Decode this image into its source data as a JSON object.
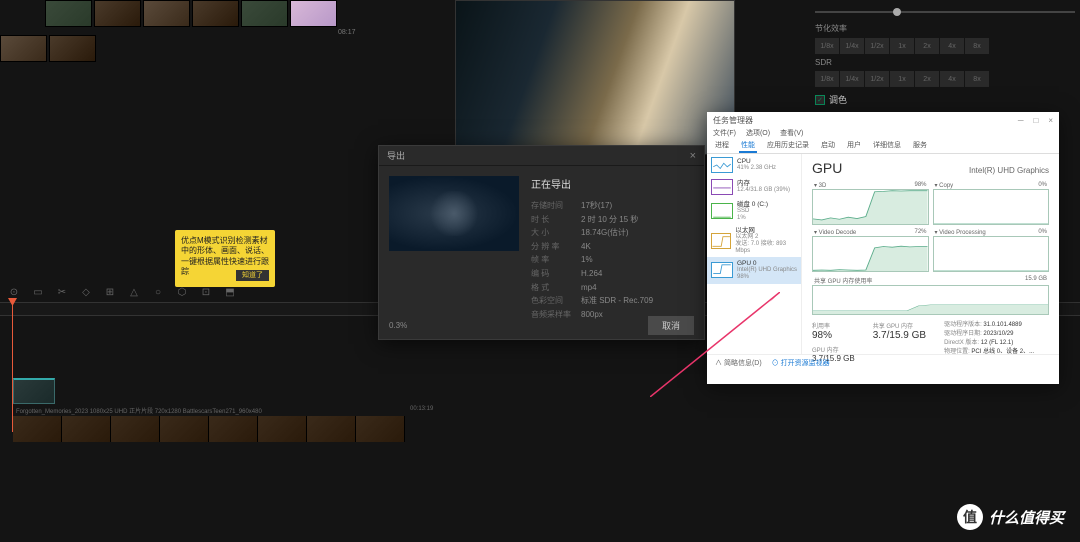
{
  "thumbs": {
    "label_time": "08:17"
  },
  "right_panel": {
    "section1": "节化效率",
    "btns1": [
      "1/8x",
      "1/4x",
      "1/2x",
      "1x",
      "2x",
      "4x",
      "8x"
    ],
    "section2": "SDR",
    "btns2": [
      "1/8x",
      "1/4x",
      "1/2x",
      "1x",
      "2x",
      "4x",
      "8x"
    ],
    "checkbox": "调色"
  },
  "tooltip": {
    "text": "优点M模式识别检测素材中的形体、画面、说话、一键根据属性快速进行跟踪",
    "btn": "知道了"
  },
  "export_dialog": {
    "header": "导出",
    "title": "正在导出",
    "rows": [
      {
        "k": "存储时间",
        "v": "17秒(17)"
      },
      {
        "k": "时 长",
        "v": "2 时 10 分 15 秒"
      },
      {
        "k": "大 小",
        "v": "18.74G(估计)"
      },
      {
        "k": "分 辨 率",
        "v": "4K"
      },
      {
        "k": "帧 率",
        "v": "1%"
      },
      {
        "k": "编 码",
        "v": "H.264"
      },
      {
        "k": "格 式",
        "v": "mp4"
      },
      {
        "k": "色彩空间",
        "v": "标准 SDR - Rec.709"
      },
      {
        "k": "音频采样率",
        "v": "800px"
      }
    ],
    "progress": "0.3%",
    "cancel": "取消"
  },
  "taskmgr": {
    "title": "任务管理器",
    "menu": [
      "文件(F)",
      "选项(O)",
      "查看(V)"
    ],
    "tabs": [
      "进程",
      "性能",
      "应用历史记录",
      "启动",
      "用户",
      "详细信息",
      "服务"
    ],
    "sidebar": [
      {
        "name": "CPU",
        "val": "41% 2.38 GHz",
        "color": "#3a9ad4"
      },
      {
        "name": "内存",
        "val": "12.4/31.8 GB (39%)",
        "color": "#8a4ab4"
      },
      {
        "name": "磁盘 0 (C:)",
        "val": "SSD\n1%",
        "color": "#4ab44a"
      },
      {
        "name": "以太网",
        "val": "以太网 2\n发送: 7.0 接收: 893 Mbps",
        "color": "#d4a43a"
      },
      {
        "name": "GPU 0",
        "val": "Intel(R) UHD Graphics\n98%",
        "color": "#3a9ad4"
      }
    ],
    "main": {
      "title": "GPU",
      "name": "Intel(R) UHD Graphics",
      "charts": [
        {
          "label": "3D",
          "pct": "98%"
        },
        {
          "label": "Copy",
          "pct": "0%"
        },
        {
          "label": "Video Decode",
          "pct": "72%"
        },
        {
          "label": "Video Processing",
          "pct": "0%"
        }
      ],
      "mem_label": "共享 GPU 内存使用率",
      "mem_max": "15.9 GB",
      "stats": {
        "util_label": "利用率",
        "util": "98%",
        "shared_label": "共享 GPU 内存",
        "shared": "3.7/15.9 GB",
        "gpu_mem_label": "GPU 内存",
        "gpu_mem": "3.7/15.9 GB",
        "driver_ver_label": "驱动程序版本:",
        "driver_ver": "31.0.101.4889",
        "driver_date_label": "驱动程序日期:",
        "driver_date": "2023/10/29",
        "dx_label": "DirectX 版本:",
        "dx": "12 (FL 12.1)",
        "loc_label": "物理位置:",
        "loc": "PCI 总线 0、设备 2、..."
      }
    },
    "footer": {
      "less": "简略信息(D)",
      "link": "打开资源监视器"
    }
  },
  "track_label": "Forgotten_Memories_2023 1080x25 UHD 正片片段 720x1280 BattlescarsTeen271_960x480",
  "track_time": "00:13:19",
  "watermark": "什么值得买",
  "chart_data": [
    {
      "type": "line",
      "title": "3D",
      "values": [
        15,
        12,
        18,
        14,
        20,
        16,
        22,
        95,
        96,
        98,
        97,
        98,
        98,
        98
      ],
      "ylim": [
        0,
        100
      ]
    },
    {
      "type": "line",
      "title": "Copy",
      "values": [
        0,
        0,
        0,
        0,
        0,
        0,
        0,
        0,
        0,
        0,
        0,
        0,
        0,
        0
      ],
      "ylim": [
        0,
        100
      ]
    },
    {
      "type": "line",
      "title": "Video Decode",
      "values": [
        2,
        3,
        2,
        4,
        3,
        2,
        3,
        68,
        72,
        70,
        73,
        71,
        72,
        72
      ],
      "ylim": [
        0,
        100
      ]
    },
    {
      "type": "line",
      "title": "Video Processing",
      "values": [
        0,
        0,
        0,
        0,
        0,
        0,
        0,
        0,
        0,
        0,
        0,
        0,
        0,
        0
      ],
      "ylim": [
        0,
        100
      ]
    },
    {
      "type": "line",
      "title": "共享 GPU 内存使用率",
      "values": [
        1.2,
        1.2,
        1.2,
        1.3,
        1.3,
        1.3,
        3.5,
        3.6,
        3.7,
        3.7,
        3.7,
        3.7,
        3.7,
        3.7
      ],
      "ylim": [
        0,
        15.9
      ]
    }
  ]
}
